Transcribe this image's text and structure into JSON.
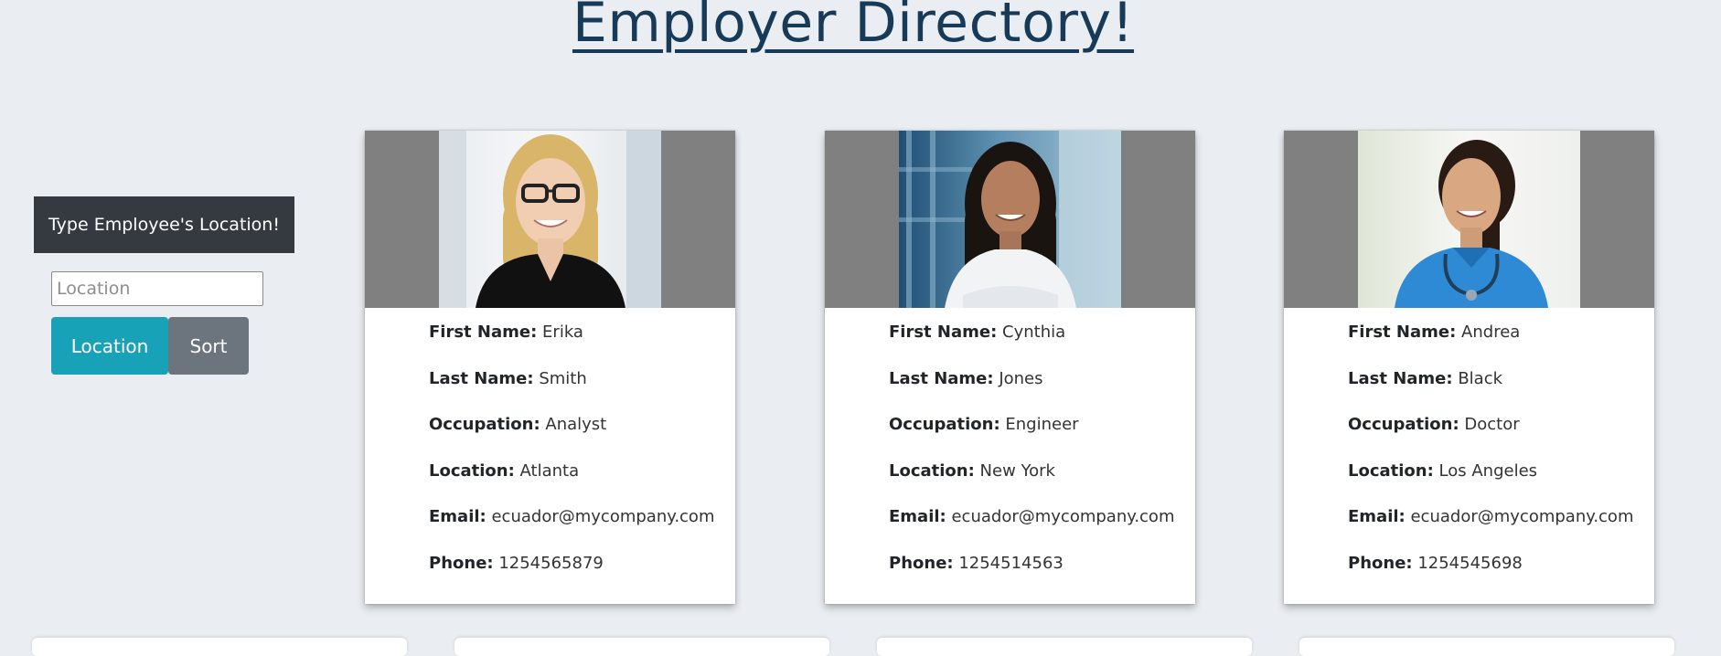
{
  "title": "Employer Directory!",
  "search": {
    "heading": "Type Employee's Location!",
    "placeholder": "Location",
    "value": "",
    "location_button": "Location",
    "sort_button": "Sort"
  },
  "labels": {
    "first_name": "First Name:",
    "last_name": "Last Name:",
    "occupation": "Occupation:",
    "location": "Location:",
    "email": "Email:",
    "phone": "Phone:"
  },
  "employees": [
    {
      "first_name": "Erika",
      "last_name": "Smith",
      "occupation": "Analyst",
      "location": "Atlanta",
      "email": "ecuador@mycompany.com",
      "phone": "1254565879"
    },
    {
      "first_name": "Cynthia",
      "last_name": "Jones",
      "occupation": "Engineer",
      "location": "New York",
      "email": "ecuador@mycompany.com",
      "phone": "1254514563"
    },
    {
      "first_name": "Andrea",
      "last_name": "Black",
      "occupation": "Doctor",
      "location": "Los Angeles",
      "email": "ecuador@mycompany.com",
      "phone": "1254545698"
    }
  ],
  "colors": {
    "background": "#eaeef2",
    "title": "#163a58",
    "heading_box": "#343a40",
    "location_button": "#17a2b8",
    "sort_button": "#6c757d",
    "photo_frame": "#808080"
  }
}
